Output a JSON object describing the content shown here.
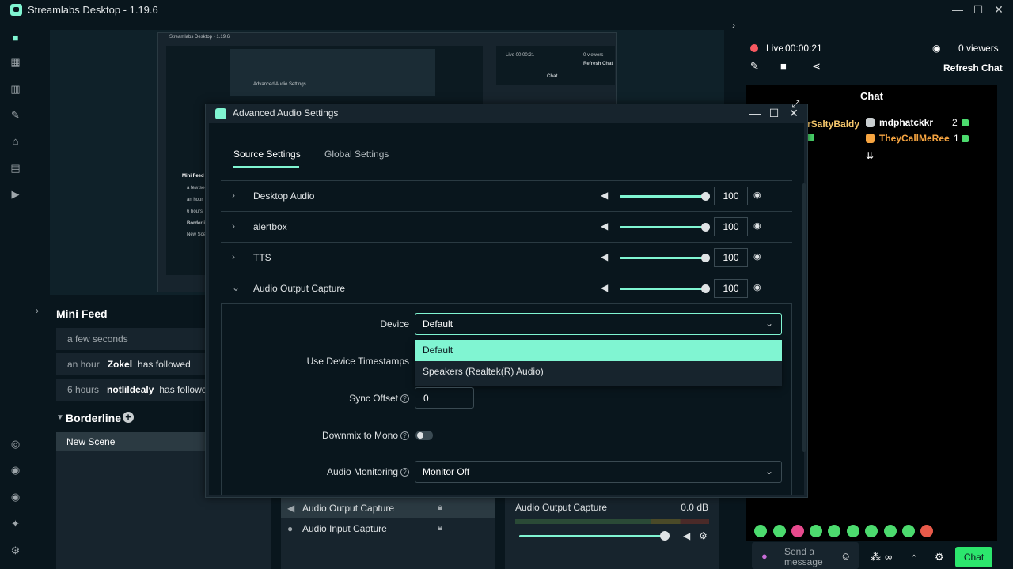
{
  "app": {
    "title": "Streamlabs Desktop - 1.19.6"
  },
  "window_controls": {
    "minimize": "—",
    "maximize": "☐",
    "close": "✕"
  },
  "nav_icons": [
    "studio-icon",
    "dashboard-icon",
    "layout-icon",
    "themes-icon",
    "store-icon",
    "media-icon",
    "play-icon"
  ],
  "nav_bottom_icons": [
    "learn-icon",
    "integrations-icon",
    "alerts-icon",
    "highlighter-icon",
    "settings-icon"
  ],
  "nested_preview": {
    "title": "Streamlabs Desktop - 1.19.6",
    "dialog_title": "Advanced Audio Settings",
    "mini_feed": "Mini Feed",
    "rows": [
      "a few seco",
      "an hour",
      "6 hours"
    ],
    "scene": "Borderli",
    "new_scene": "New Scen",
    "live": "Live 00:00:21",
    "viewers": "0 viewers",
    "refresh": "Refresh Chat",
    "chat": "Chat",
    "user1": "rSaltyBaldy",
    "user2": "mdphatckkr",
    "user3": "TheyCallMeRee",
    "tab1": "Source Settings",
    "tab2": "Global Settings"
  },
  "mini_feed": {
    "title": "Mini Feed",
    "rows": [
      {
        "time": "a few seconds",
        "name": "",
        "action": ""
      },
      {
        "time": "an hour",
        "name": "Zokel",
        "action": "has followed"
      },
      {
        "time": "6 hours",
        "name": "notlildealy",
        "action": "has followed"
      }
    ]
  },
  "scenes": {
    "collection": "Borderline",
    "items": [
      "New Scene"
    ]
  },
  "sources": {
    "items": [
      {
        "label": "Audio Output Capture",
        "icon": "speaker-icon"
      },
      {
        "label": "Audio Input Capture",
        "icon": "mic-icon"
      }
    ]
  },
  "mixer": {
    "name": "Audio Output Capture",
    "level": "0.0 dB",
    "volume_fraction": 1.0
  },
  "right_panel": {
    "live": "Live",
    "timer": "00:00:21",
    "viewers": "0 viewers",
    "refresh": "Refresh Chat",
    "chat_title": "Chat",
    "chat_users": [
      {
        "name": "rSaltyBaldy",
        "count": ""
      },
      {
        "name": "mdphatckkr",
        "count": "2"
      },
      {
        "name": "TheyCallMeRee",
        "count": "1"
      }
    ],
    "send_placeholder_1": "Send a",
    "send_placeholder_2": "message",
    "chat_button": "Chat"
  },
  "dialog": {
    "title": "Advanced Audio Settings",
    "tabs": [
      "Source Settings",
      "Global Settings"
    ],
    "active_tab": "Source Settings",
    "sources": [
      {
        "name": "Desktop Audio",
        "volume": "100",
        "expanded": false
      },
      {
        "name": "alertbox",
        "volume": "100",
        "expanded": false
      },
      {
        "name": "TTS",
        "volume": "100",
        "expanded": false
      },
      {
        "name": "Audio Output Capture",
        "volume": "100",
        "expanded": true
      }
    ],
    "fields": {
      "device_label": "Device",
      "device_value": "Default",
      "device_options": [
        "Default",
        "Speakers (Realtek(R) Audio)"
      ],
      "timestamps_label": "Use Device Timestamps",
      "sync_label": "Sync Offset",
      "sync_value": "0",
      "downmix_label": "Downmix to Mono",
      "downmix_on": false,
      "monitoring_label": "Audio Monitoring",
      "monitoring_value": "Monitor Off"
    }
  },
  "colors": {
    "accent": "#80f5d2",
    "live": "#f85961",
    "chat_button": "#2ce66d",
    "background": "#09161d"
  }
}
